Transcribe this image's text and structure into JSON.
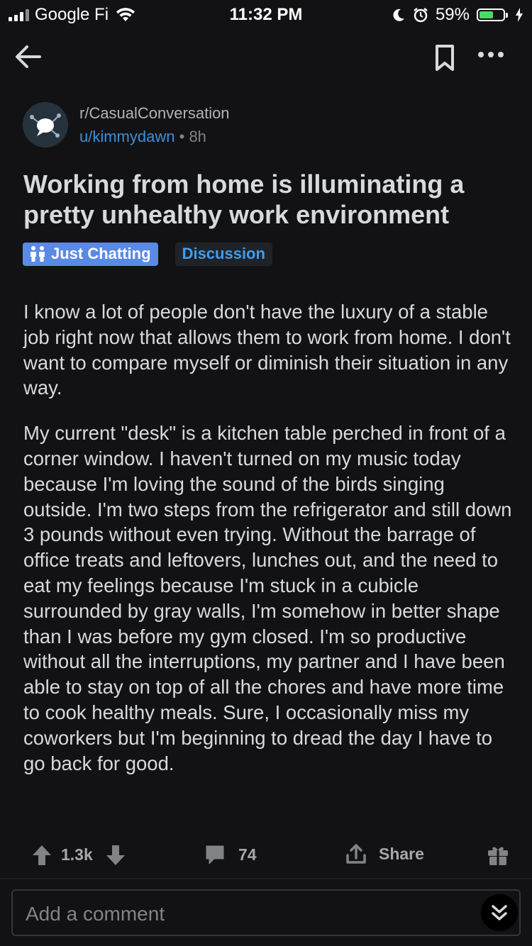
{
  "status_bar": {
    "carrier": "Google Fi",
    "time": "11:32 PM",
    "battery_percent": "59%",
    "battery_level": 0.59
  },
  "header": {
    "back_icon": "arrow-left-icon",
    "bookmark_icon": "bookmark-icon",
    "more_icon": "ellipsis-icon"
  },
  "post": {
    "subreddit": "r/CasualConversation",
    "author": "u/kimmydawn",
    "separator": "•",
    "age": "8h",
    "title": "Working from home is illuminating a pretty unhealthy work environment",
    "flairs": [
      {
        "label": "Just Chatting",
        "color": "#5b8ae6"
      },
      {
        "label": "Discussion",
        "color": "#3d9ef0"
      }
    ],
    "body": [
      "I know a lot of people don't have the luxury of a stable job right now that allows them to work from home. I don't want to compare myself or diminish their situation in any way.",
      "My current \"desk\" is a kitchen table perched in front of a corner window. I haven't turned on my music today because I'm loving the sound of the birds singing outside. I'm two steps from the refrigerator and still down 3 pounds without even trying. Without the barrage of office treats and leftovers, lunches out, and the need to eat my feelings because I'm stuck in a cubicle surrounded by gray walls, I'm somehow in better shape than I was before my gym closed. I'm so productive without all the interruptions, my partner and I have been able to stay on top of all the chores and have more time to cook healthy meals. Sure, I occasionally miss my coworkers but I'm beginning to dread the day I have to go back for good."
    ]
  },
  "actions": {
    "votes": "1.3k",
    "comments": "74",
    "share": "Share"
  },
  "comment": {
    "placeholder": "Add a comment"
  },
  "colors": {
    "background": "#121214",
    "link": "#3d8fd9",
    "flair_discussion": "#3d9ef0",
    "battery": "#4cd964"
  }
}
